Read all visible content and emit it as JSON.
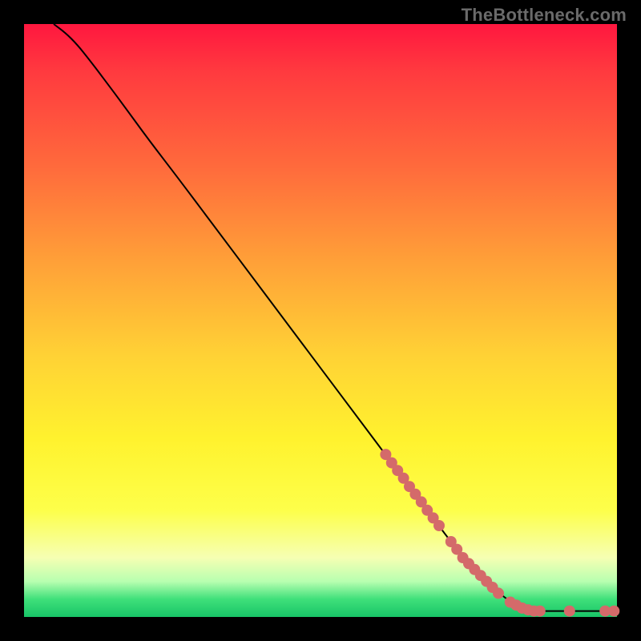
{
  "watermark": "TheBottleneck.com",
  "colors": {
    "curve_stroke": "#000000",
    "dot_fill": "#d46a6a",
    "background_black": "#000000"
  },
  "chart_data": {
    "type": "line",
    "title": "",
    "xlabel": "",
    "ylabel": "",
    "xlim": [
      0,
      1
    ],
    "ylim": [
      0,
      1
    ],
    "curve": [
      {
        "x": 0.05,
        "y": 1.0
      },
      {
        "x": 0.07,
        "y": 0.985
      },
      {
        "x": 0.09,
        "y": 0.965
      },
      {
        "x": 0.11,
        "y": 0.94
      },
      {
        "x": 0.135,
        "y": 0.907
      },
      {
        "x": 0.17,
        "y": 0.86
      },
      {
        "x": 0.21,
        "y": 0.805
      },
      {
        "x": 0.26,
        "y": 0.74
      },
      {
        "x": 0.32,
        "y": 0.66
      },
      {
        "x": 0.38,
        "y": 0.58
      },
      {
        "x": 0.44,
        "y": 0.5
      },
      {
        "x": 0.5,
        "y": 0.42
      },
      {
        "x": 0.56,
        "y": 0.34
      },
      {
        "x": 0.62,
        "y": 0.26
      },
      {
        "x": 0.68,
        "y": 0.18
      },
      {
        "x": 0.74,
        "y": 0.1
      },
      {
        "x": 0.8,
        "y": 0.04
      },
      {
        "x": 0.83,
        "y": 0.02
      },
      {
        "x": 0.86,
        "y": 0.01
      },
      {
        "x": 0.9,
        "y": 0.01
      },
      {
        "x": 0.95,
        "y": 0.01
      },
      {
        "x": 0.995,
        "y": 0.01
      }
    ],
    "dots": [
      {
        "x": 0.61,
        "y": 0.274
      },
      {
        "x": 0.62,
        "y": 0.26
      },
      {
        "x": 0.63,
        "y": 0.247
      },
      {
        "x": 0.64,
        "y": 0.234
      },
      {
        "x": 0.65,
        "y": 0.22
      },
      {
        "x": 0.66,
        "y": 0.207
      },
      {
        "x": 0.67,
        "y": 0.194
      },
      {
        "x": 0.68,
        "y": 0.18
      },
      {
        "x": 0.69,
        "y": 0.167
      },
      {
        "x": 0.7,
        "y": 0.154
      },
      {
        "x": 0.72,
        "y": 0.127
      },
      {
        "x": 0.73,
        "y": 0.114
      },
      {
        "x": 0.74,
        "y": 0.1
      },
      {
        "x": 0.75,
        "y": 0.09
      },
      {
        "x": 0.76,
        "y": 0.08
      },
      {
        "x": 0.77,
        "y": 0.07
      },
      {
        "x": 0.78,
        "y": 0.06
      },
      {
        "x": 0.79,
        "y": 0.05
      },
      {
        "x": 0.8,
        "y": 0.04
      },
      {
        "x": 0.82,
        "y": 0.025
      },
      {
        "x": 0.83,
        "y": 0.02
      },
      {
        "x": 0.84,
        "y": 0.015
      },
      {
        "x": 0.85,
        "y": 0.012
      },
      {
        "x": 0.86,
        "y": 0.01
      },
      {
        "x": 0.87,
        "y": 0.01
      },
      {
        "x": 0.92,
        "y": 0.01
      },
      {
        "x": 0.98,
        "y": 0.01
      },
      {
        "x": 0.995,
        "y": 0.01
      }
    ]
  }
}
